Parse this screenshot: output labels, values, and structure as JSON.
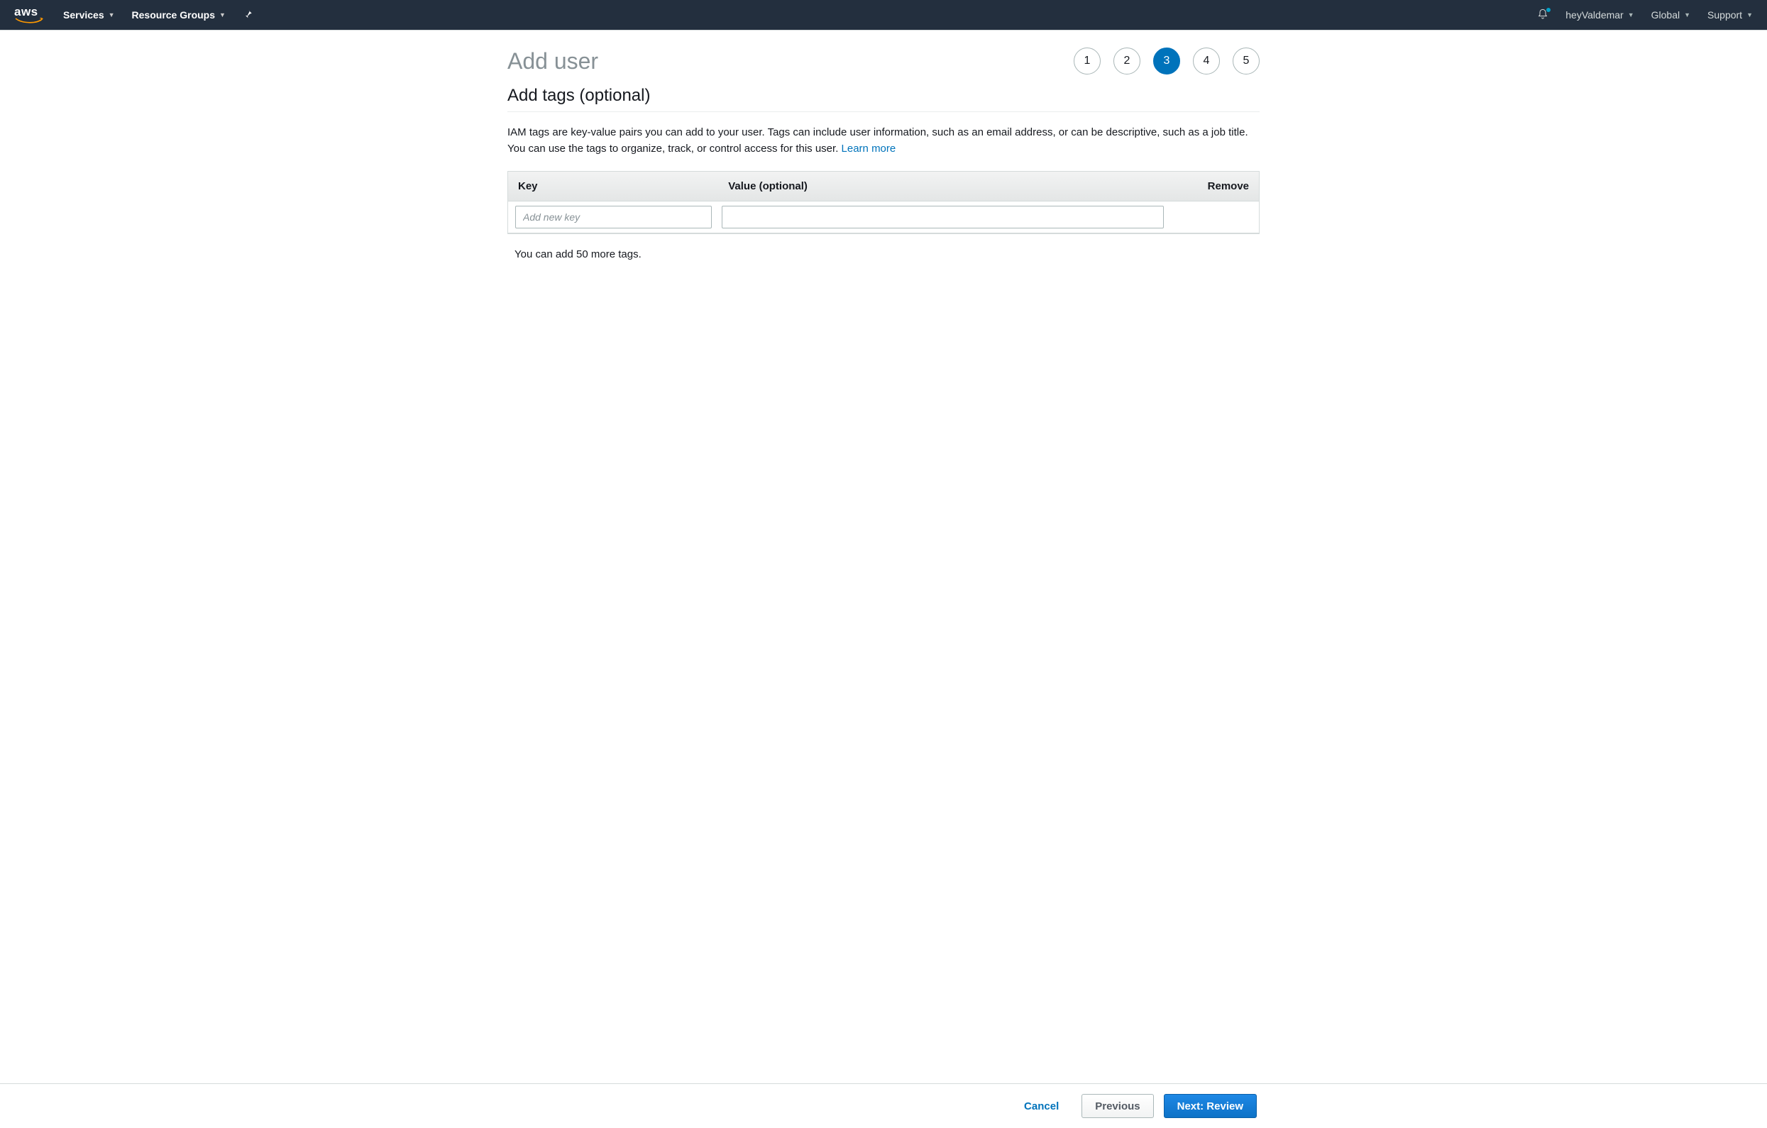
{
  "nav": {
    "services": "Services",
    "resource_groups": "Resource Groups",
    "account": "heyValdemar",
    "region": "Global",
    "support": "Support"
  },
  "page": {
    "title": "Add user",
    "steps": [
      "1",
      "2",
      "3",
      "4",
      "5"
    ],
    "active_step_index": 2
  },
  "section": {
    "heading": "Add tags (optional)",
    "description_pre": "IAM tags are key-value pairs you can add to your user. Tags can include user information, such as an email address, or can be descriptive, such as a job title. You can use the tags to organize, track, or control access for this user. ",
    "learn_more": "Learn more"
  },
  "table": {
    "col_key": "Key",
    "col_value": "Value (optional)",
    "col_remove": "Remove",
    "key_placeholder": "Add new key",
    "value_placeholder": ""
  },
  "tags_left": "You can add 50 more tags.",
  "footer": {
    "cancel": "Cancel",
    "previous": "Previous",
    "next": "Next: Review"
  }
}
